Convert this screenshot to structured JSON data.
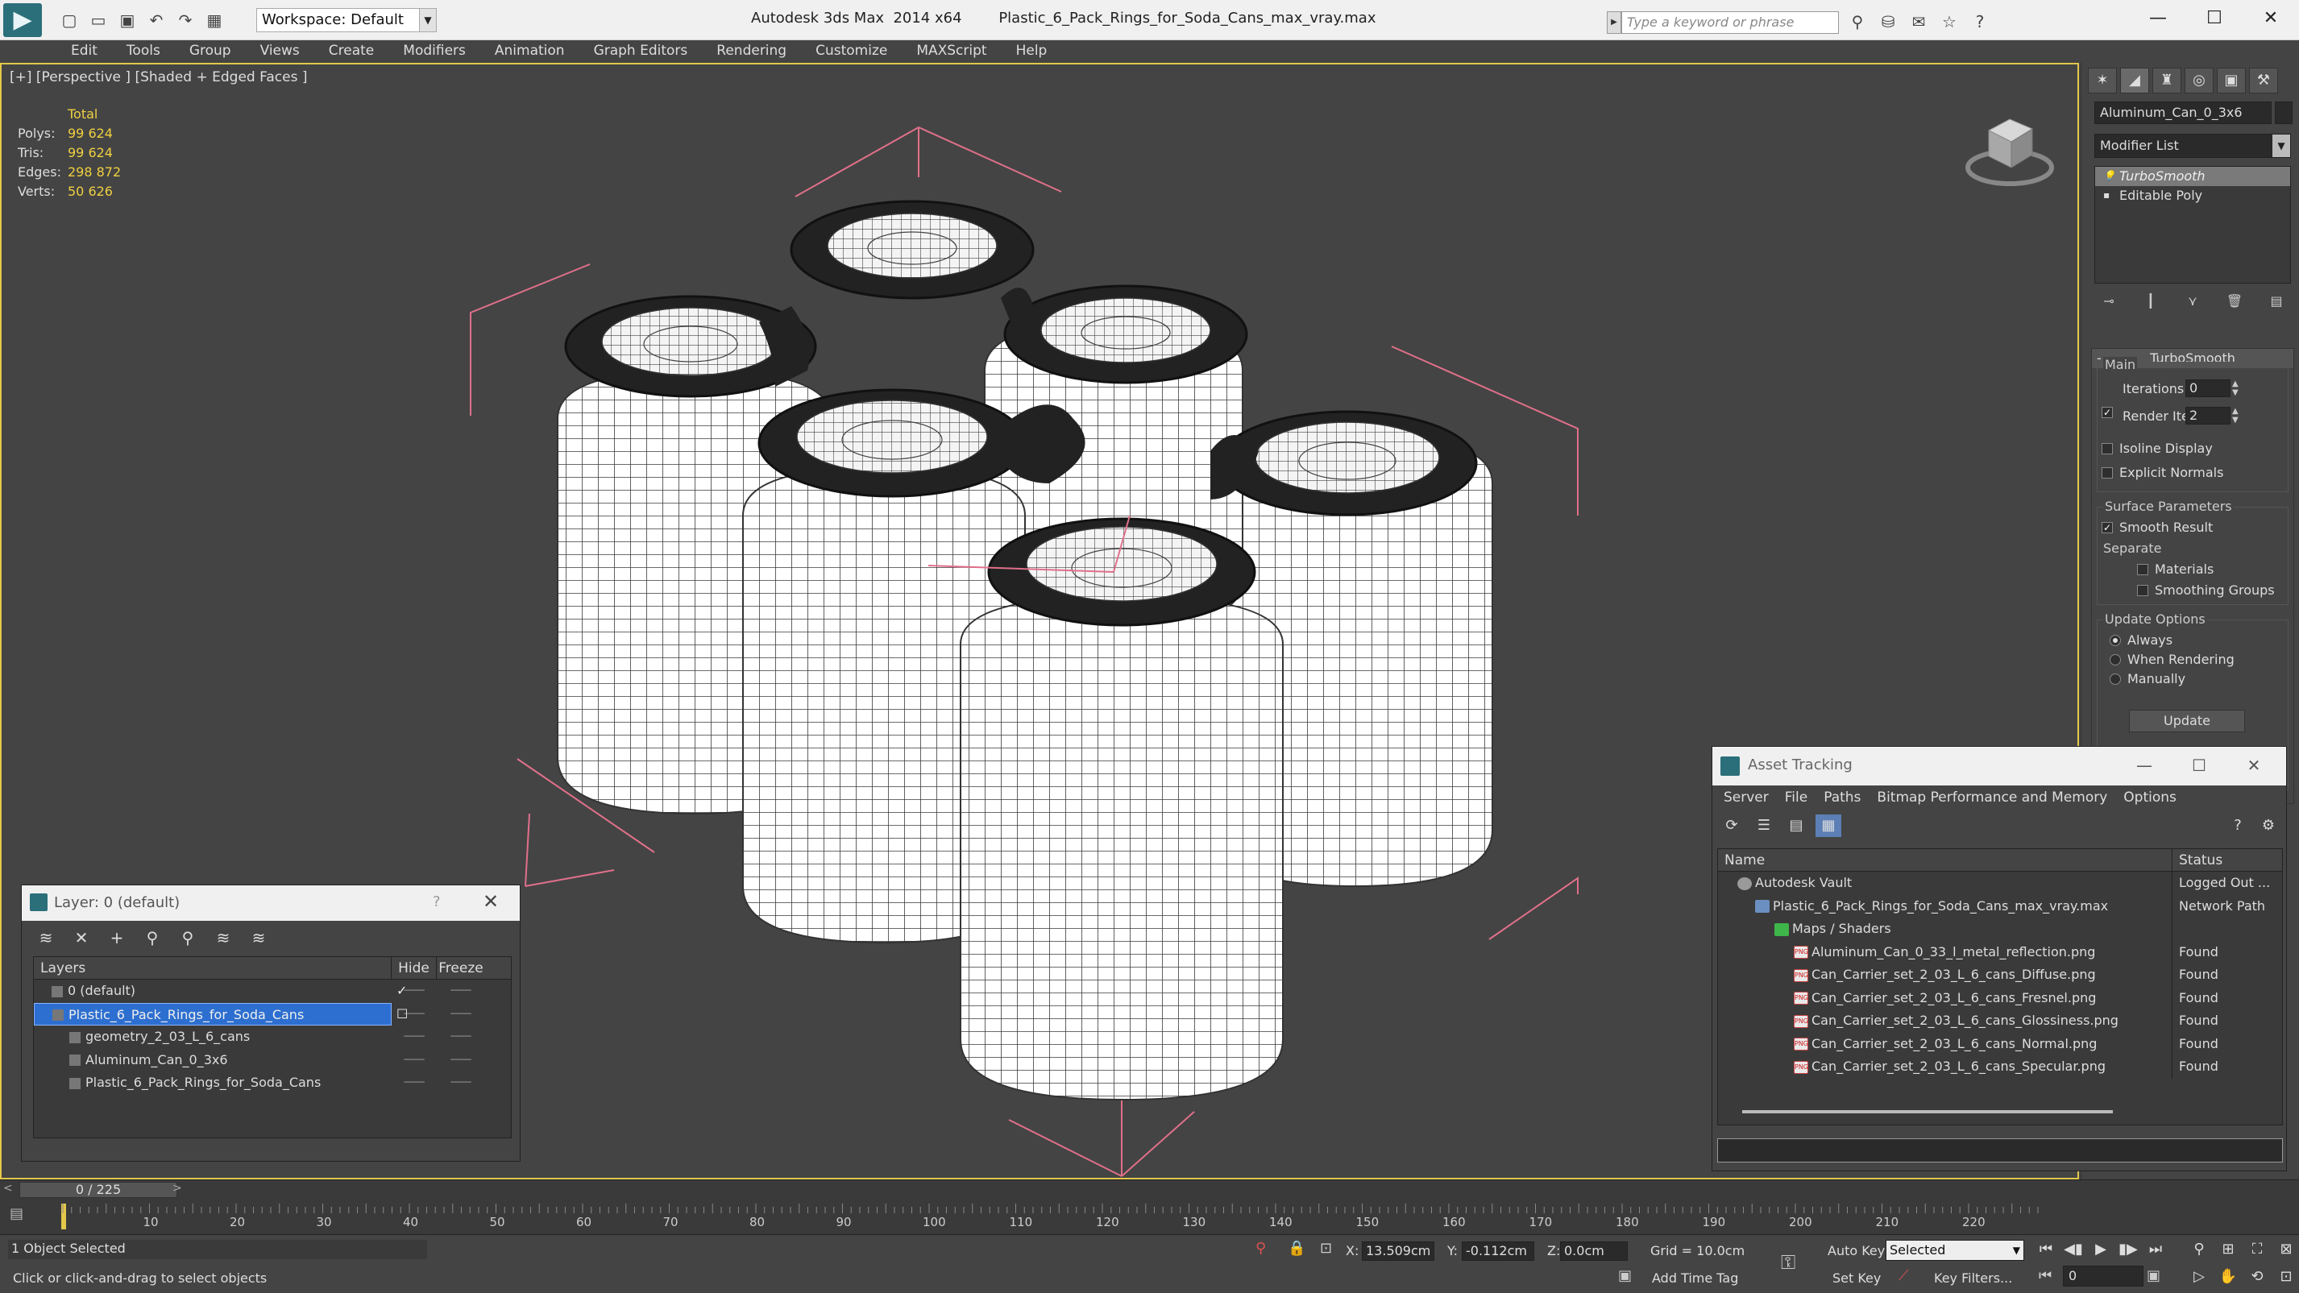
{
  "titlebar": {
    "app_name": "Autodesk 3ds Max  2014 x64",
    "file_name": "Plastic_6_Pack_Rings_for_Soda_Cans_max_vray.max",
    "workspace": "Workspace: Default",
    "search_placeholder": "Type a keyword or phrase"
  },
  "menu": [
    "Edit",
    "Tools",
    "Group",
    "Views",
    "Create",
    "Modifiers",
    "Animation",
    "Graph Editors",
    "Rendering",
    "Customize",
    "MAXScript",
    "Help"
  ],
  "viewport": {
    "label": "[+] [Perspective ] [Shaded + Edged Faces ]",
    "stats": {
      "header": "Total",
      "rows": [
        {
          "k": "Polys:",
          "v": "99 624"
        },
        {
          "k": "Tris:",
          "v": "99 624"
        },
        {
          "k": "Edges:",
          "v": "298 872"
        },
        {
          "k": "Verts:",
          "v": "50 626"
        }
      ]
    }
  },
  "command_panel": {
    "object_name": "Aluminum_Can_0_3x6",
    "modifier_list": "Modifier List",
    "stack": [
      "TurboSmooth",
      "Editable Poly"
    ],
    "rollout_title": "TurboSmooth",
    "main_label": "Main",
    "iterations_label": "Iterations:",
    "iterations_value": "0",
    "render_iters_label": "Render Iters:",
    "render_iters_value": "2",
    "isoline_label": "Isoline Display",
    "explicit_normals_label": "Explicit Normals",
    "surface_params_label": "Surface Parameters",
    "smooth_result_label": "Smooth Result",
    "separate_label": "Separate",
    "materials_label": "Materials",
    "smoothing_groups_label": "Smoothing Groups",
    "update_options_label": "Update Options",
    "always_label": "Always",
    "when_rendering_label": "When Rendering",
    "manually_label": "Manually",
    "update_button": "Update"
  },
  "asset_tracking": {
    "title": "Asset Tracking",
    "menu": [
      "Server",
      "File",
      "Paths",
      "Bitmap Performance and Memory",
      "Options"
    ],
    "col_name": "Name",
    "col_status": "Status",
    "rows": [
      {
        "name": "Autodesk Vault",
        "status": "Logged Out ..."
      },
      {
        "name": "Plastic_6_Pack_Rings_for_Soda_Cans_max_vray.max",
        "status": "Network Path"
      },
      {
        "name": "Maps / Shaders",
        "status": ""
      },
      {
        "name": "Aluminum_Can_0_33_l_metal_reflection.png",
        "status": "Found"
      },
      {
        "name": "Can_Carrier_set_2_03_L_6_cans_Diffuse.png",
        "status": "Found"
      },
      {
        "name": "Can_Carrier_set_2_03_L_6_cans_Fresnel.png",
        "status": "Found"
      },
      {
        "name": "Can_Carrier_set_2_03_L_6_cans_Glossiness.png",
        "status": "Found"
      },
      {
        "name": "Can_Carrier_set_2_03_L_6_cans_Normal.png",
        "status": "Found"
      },
      {
        "name": "Can_Carrier_set_2_03_L_6_cans_Specular.png",
        "status": "Found"
      }
    ]
  },
  "layer_dialog": {
    "title": "Layer: 0 (default)",
    "help": "?",
    "col_layers": "Layers",
    "col_hide": "Hide",
    "col_freeze": "Freeze",
    "rows": [
      {
        "name": "0 (default)"
      },
      {
        "name": "Plastic_6_Pack_Rings_for_Soda_Cans"
      },
      {
        "name": "geometry_2_03_L_6_cans"
      },
      {
        "name": "Aluminum_Can_0_3x6"
      },
      {
        "name": "Plastic_6_Pack_Rings_for_Soda_Cans"
      }
    ]
  },
  "timeline": {
    "frame_display": "0 / 225",
    "ticks": [
      "10",
      "20",
      "30",
      "40",
      "50",
      "60",
      "70",
      "80",
      "90",
      "100",
      "110",
      "120",
      "130",
      "140",
      "150",
      "160",
      "170",
      "180",
      "190",
      "200",
      "210",
      "220"
    ]
  },
  "status": {
    "selection": "1 Object Selected",
    "prompt": "Click or click-and-drag to select objects",
    "x_label": "X:",
    "x_value": "13.509cm",
    "y_label": "Y:",
    "y_value": "-0.112cm",
    "z_label": "Z:",
    "z_value": "0.0cm",
    "grid": "Grid = 10.0cm",
    "auto_key": "Auto Key",
    "set_key": "Set Key",
    "selected_option": "Selected",
    "key_filters": "Key Filters...",
    "add_time_tag": "Add Time Tag",
    "frame_value": "0"
  }
}
